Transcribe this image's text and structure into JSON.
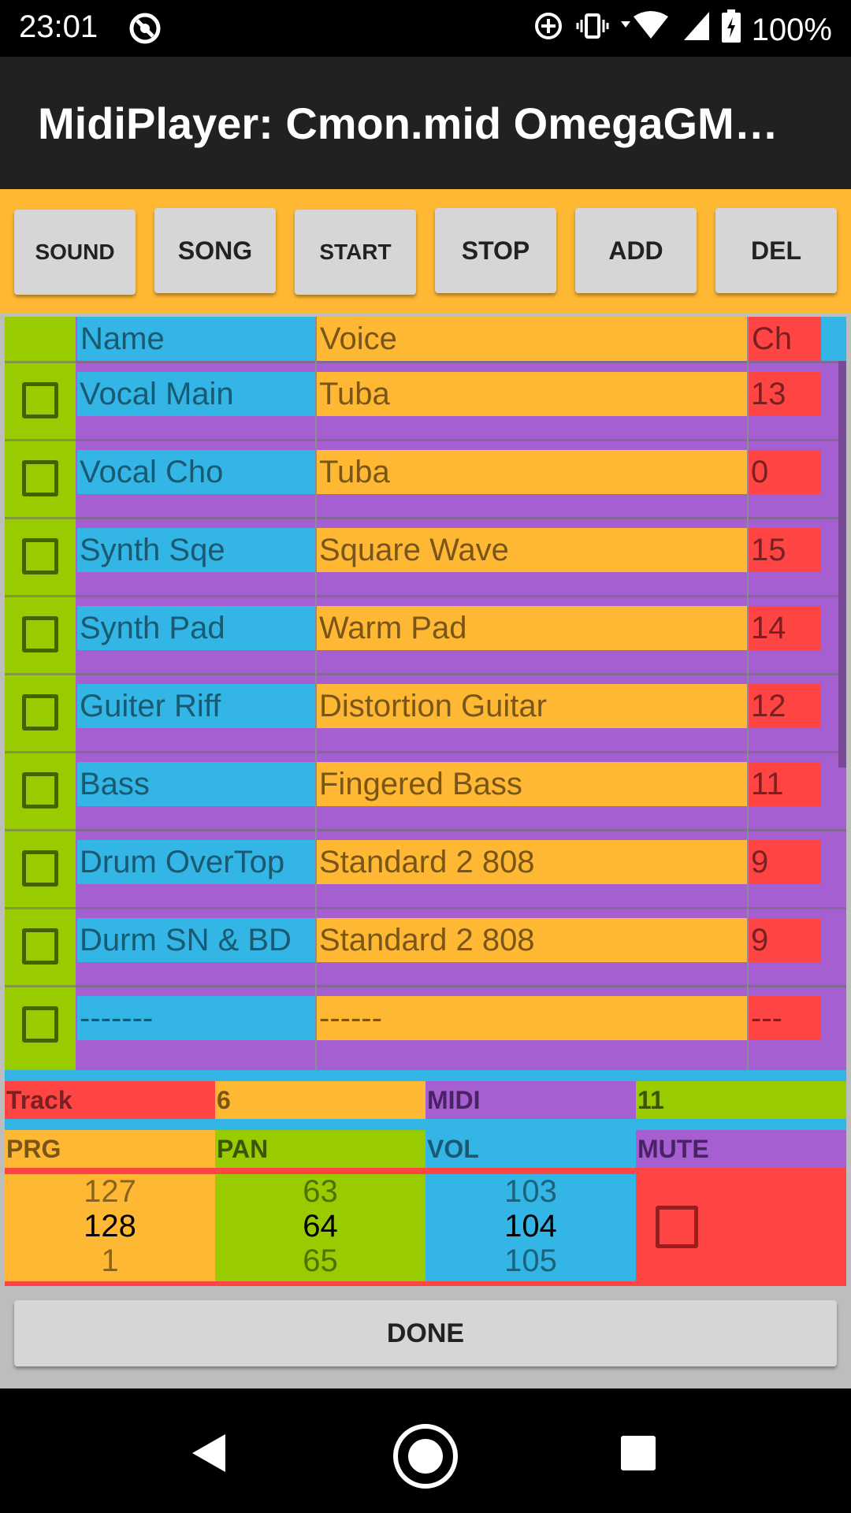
{
  "status": {
    "time": "23:01",
    "battery": "100%"
  },
  "app": {
    "title": "MidiPlayer: Cmon.mid OmegaGM…"
  },
  "toolbar": {
    "sound": "SOUND",
    "song": "SONG",
    "start": "START",
    "stop": "STOP",
    "add": "ADD",
    "del": "DEL"
  },
  "table": {
    "headers": {
      "name": "Name",
      "voice": "Voice",
      "ch": "Ch"
    },
    "rows": [
      {
        "name": "Vocal Main",
        "voice": "Tuba",
        "ch": "13"
      },
      {
        "name": "Vocal Cho",
        "voice": "Tuba",
        "ch": "0"
      },
      {
        "name": "Synth Sqe",
        "voice": "Square Wave",
        "ch": "15"
      },
      {
        "name": "Synth Pad",
        "voice": "Warm Pad",
        "ch": "14"
      },
      {
        "name": "Guiter Riff",
        "voice": "Distortion Guitar",
        "ch": "12"
      },
      {
        "name": "Bass",
        "voice": "Fingered Bass",
        "ch": "11"
      },
      {
        "name": "Drum OverTop",
        "voice": "Standard 2 808",
        "ch": "9"
      },
      {
        "name": "Durm SN & BD",
        "voice": "Standard 2 808",
        "ch": "9"
      },
      {
        "name": "-------",
        "voice": "------",
        "ch": "---"
      }
    ]
  },
  "panel": {
    "track_label": "Track",
    "track_value": "6",
    "midi_label": "MIDI",
    "midi_value": "11",
    "prg_label": "PRG",
    "pan_label": "PAN",
    "vol_label": "VOL",
    "mute_label": "MUTE",
    "prg": {
      "prev": "127",
      "current": "128",
      "next": "1"
    },
    "pan": {
      "prev": "63",
      "current": "64",
      "next": "65"
    },
    "vol": {
      "prev": "103",
      "current": "104",
      "next": "105"
    }
  },
  "done_label": "DONE",
  "colors": {
    "orange": "#ffb833",
    "blue": "#33b5e5",
    "purple": "#a55fd0",
    "green": "#99cc00",
    "red": "#ff4444"
  }
}
